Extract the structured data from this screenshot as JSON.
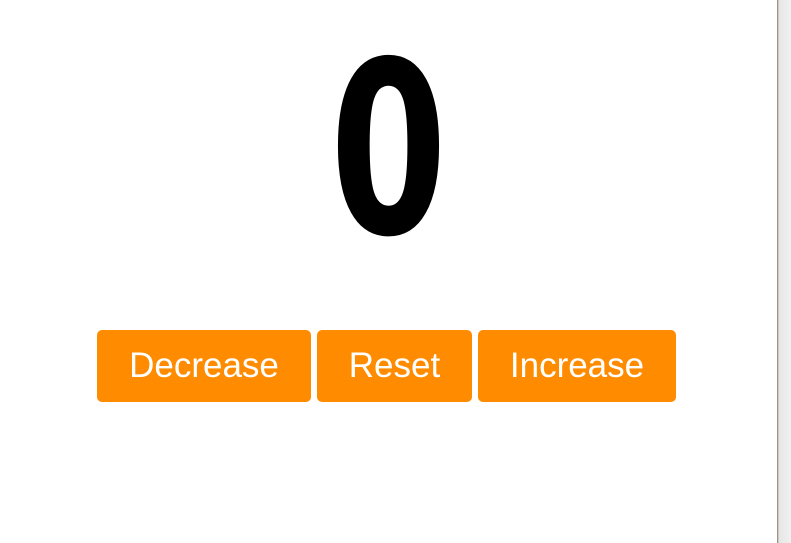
{
  "counter": {
    "value": "0"
  },
  "controls": {
    "decrease_label": "Decrease",
    "reset_label": "Reset",
    "increase_label": "Increase"
  },
  "colors": {
    "button_background": "#ff8c00",
    "button_text": "#ffffff",
    "counter_text": "#000000",
    "page_background": "#ffffff"
  }
}
